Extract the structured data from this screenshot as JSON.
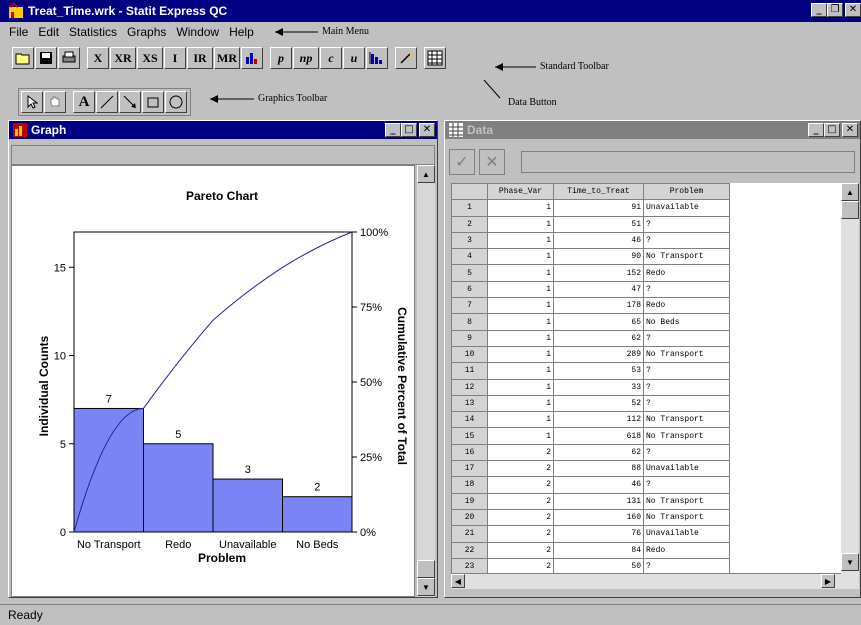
{
  "window": {
    "title": "Treat_Time.wrk - Statit Express QC"
  },
  "menu": [
    "File",
    "Edit",
    "Statistics",
    "Graphs",
    "Window",
    "Help"
  ],
  "annotations": {
    "main_menu": "Main Menu",
    "standard_toolbar": "Standard Toolbar",
    "graphics_toolbar": "Graphics Toolbar",
    "data_button": "Data Button"
  },
  "toolbar": [
    "open-icon",
    "save-icon",
    "print-icon",
    "X",
    "XR",
    "XS",
    "I",
    "IR",
    "MR",
    "histogram-icon",
    "p",
    "np",
    "c",
    "u",
    "pareto-icon",
    "wand-icon",
    "data-icon"
  ],
  "graphics_toolbar": [
    "pointer-icon",
    "hand-icon",
    "A",
    "line-icon",
    "arrow-icon",
    "rectangle-icon",
    "ellipse-icon"
  ],
  "graph_window": {
    "title": "Graph"
  },
  "chart_data": {
    "type": "bar",
    "title": "Pareto Chart",
    "categories": [
      "No Transport",
      "Redo",
      "Unavailable",
      "No Beds"
    ],
    "values": [
      7,
      5,
      3,
      2
    ],
    "cumulative_percent": [
      41.2,
      70.6,
      88.2,
      100
    ],
    "xlabel": "Problem",
    "ylabel": "Individual Counts",
    "ylabel_right": "Cumulative Percent of Total",
    "yticks": [
      "0",
      "5",
      "10",
      "15"
    ],
    "yticks_right": [
      "0%",
      "25%",
      "50%",
      "75%",
      "100%"
    ],
    "ylim": [
      0,
      17
    ],
    "bar_color": "#7b84f5",
    "line_color": "#2020a0"
  },
  "data_window": {
    "title": "Data",
    "columns": [
      "Phase_Var",
      "Time_to_Treat",
      "Problem"
    ],
    "rows": [
      [
        "1",
        "1",
        "91",
        "Unavailable"
      ],
      [
        "2",
        "1",
        "51",
        "?"
      ],
      [
        "3",
        "1",
        "46",
        "?"
      ],
      [
        "4",
        "1",
        "90",
        "No Transport"
      ],
      [
        "5",
        "1",
        "152",
        "Redo"
      ],
      [
        "6",
        "1",
        "47",
        "?"
      ],
      [
        "7",
        "1",
        "178",
        "Redo"
      ],
      [
        "8",
        "1",
        "65",
        "No Beds"
      ],
      [
        "9",
        "1",
        "62",
        "?"
      ],
      [
        "10",
        "1",
        "289",
        "No Transport"
      ],
      [
        "11",
        "1",
        "53",
        "?"
      ],
      [
        "12",
        "1",
        "33",
        "?"
      ],
      [
        "13",
        "1",
        "52",
        "?"
      ],
      [
        "14",
        "1",
        "112",
        "No Transport"
      ],
      [
        "15",
        "1",
        "618",
        "No Transport"
      ],
      [
        "16",
        "2",
        "62",
        "?"
      ],
      [
        "17",
        "2",
        "88",
        "Unavailable"
      ],
      [
        "18",
        "2",
        "46",
        "?"
      ],
      [
        "19",
        "2",
        "131",
        "No Transport"
      ],
      [
        "20",
        "2",
        "160",
        "No Transport"
      ],
      [
        "21",
        "2",
        "76",
        "Unavailable"
      ],
      [
        "22",
        "2",
        "84",
        "Redo"
      ],
      [
        "23",
        "2",
        "50",
        "?"
      ]
    ]
  },
  "status": "Ready"
}
